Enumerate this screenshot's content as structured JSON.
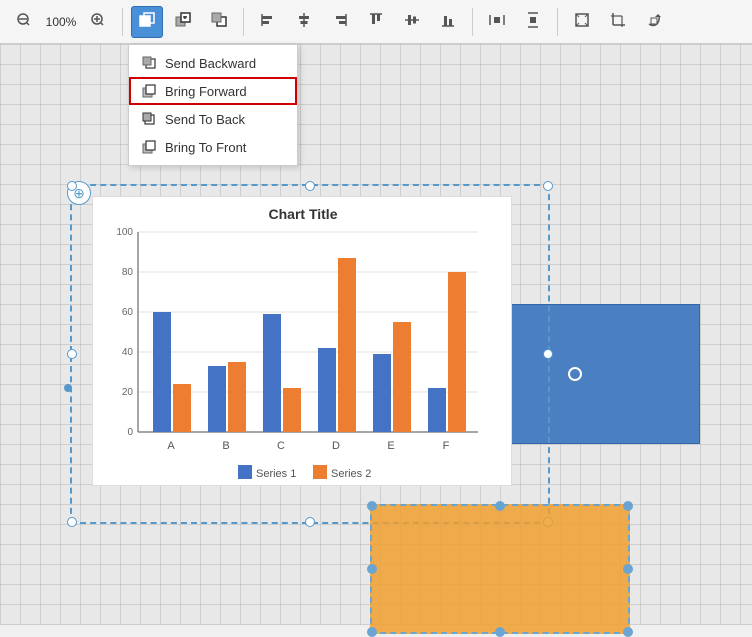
{
  "toolbar": {
    "zoom_level": "100%",
    "active_button": "layer-order",
    "buttons": [
      {
        "id": "zoom-out",
        "label": "−",
        "icon": "zoom-out-icon"
      },
      {
        "id": "zoom-level",
        "label": "100%"
      },
      {
        "id": "zoom-in",
        "label": "+",
        "icon": "zoom-in-icon"
      },
      {
        "id": "layer-order",
        "label": "⧉",
        "active": true
      },
      {
        "id": "bring-forward-toolbar",
        "label": "↑⧉"
      },
      {
        "id": "send-backward-toolbar",
        "label": "↓⧉"
      },
      {
        "id": "align-left",
        "label": "⫷"
      },
      {
        "id": "align-center-h",
        "label": "⫸"
      },
      {
        "id": "align-right-h",
        "label": "⫸"
      },
      {
        "id": "align-top",
        "label": "⫷"
      },
      {
        "id": "align-center-v",
        "label": "⫸"
      },
      {
        "id": "align-bottom",
        "label": "⫸"
      },
      {
        "id": "distribute-h",
        "label": "≡"
      },
      {
        "id": "distribute-v",
        "label": "≡"
      },
      {
        "id": "fit-page",
        "label": "⊞"
      },
      {
        "id": "crop",
        "label": "⊡"
      },
      {
        "id": "rotate",
        "label": "↺"
      }
    ]
  },
  "dropdown": {
    "items": [
      {
        "id": "send-backward",
        "label": "Send Backward"
      },
      {
        "id": "bring-forward",
        "label": "Bring Forward",
        "highlighted": true
      },
      {
        "id": "send-to-back",
        "label": "Send To Back"
      },
      {
        "id": "bring-to-front",
        "label": "Bring To Front"
      }
    ]
  },
  "chart": {
    "title": "Chart Title",
    "series": [
      {
        "name": "Series 1",
        "color": "#4472c4"
      },
      {
        "name": "Series 2",
        "color": "#ed7d31"
      }
    ],
    "categories": [
      "A",
      "B",
      "C",
      "D",
      "E",
      "F"
    ],
    "data": {
      "series1": [
        60,
        33,
        59,
        42,
        39,
        22
      ],
      "series2": [
        24,
        35,
        22,
        87,
        55,
        80
      ]
    },
    "yAxis": {
      "max": 100,
      "ticks": [
        0,
        20,
        40,
        60,
        80,
        100
      ]
    }
  }
}
